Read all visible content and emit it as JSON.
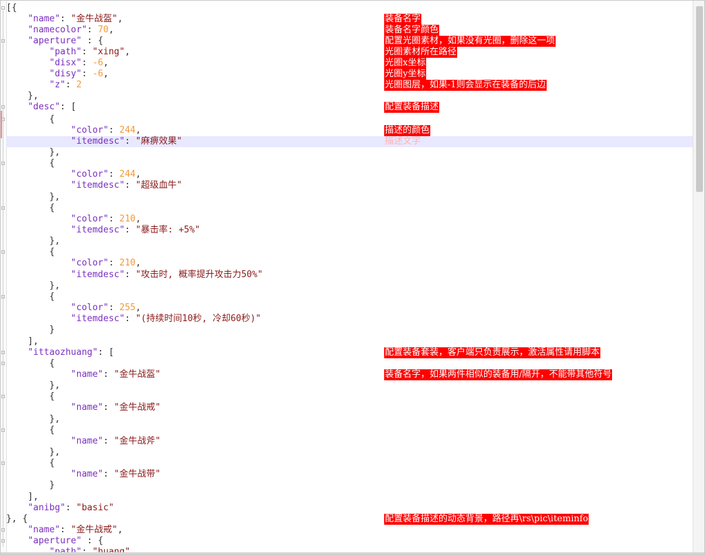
{
  "editor": {
    "current_line_index": 12,
    "lines": [
      [
        [
          "p",
          "[{"
        ]
      ],
      [
        [
          "p",
          "    "
        ],
        [
          "k",
          "\"name\""
        ],
        [
          "p",
          ": "
        ],
        [
          "s",
          "\"金牛战盔\""
        ],
        [
          "p",
          ","
        ]
      ],
      [
        [
          "p",
          "    "
        ],
        [
          "k",
          "\"namecolor\""
        ],
        [
          "p",
          ": "
        ],
        [
          "n",
          "70"
        ],
        [
          "p",
          ","
        ]
      ],
      [
        [
          "p",
          "    "
        ],
        [
          "k",
          "\"aperture\""
        ],
        [
          "p",
          " : {"
        ]
      ],
      [
        [
          "p",
          "        "
        ],
        [
          "k",
          "\"path\""
        ],
        [
          "p",
          ": "
        ],
        [
          "s",
          "\"xing\""
        ],
        [
          "p",
          ","
        ]
      ],
      [
        [
          "p",
          "        "
        ],
        [
          "k",
          "\"disx\""
        ],
        [
          "p",
          ": "
        ],
        [
          "n",
          "-6"
        ],
        [
          "p",
          ","
        ]
      ],
      [
        [
          "p",
          "        "
        ],
        [
          "k",
          "\"disy\""
        ],
        [
          "p",
          ": "
        ],
        [
          "n",
          "-6"
        ],
        [
          "p",
          ","
        ]
      ],
      [
        [
          "p",
          "        "
        ],
        [
          "k",
          "\"z\""
        ],
        [
          "p",
          ": "
        ],
        [
          "n",
          "2"
        ]
      ],
      [
        [
          "p",
          "    },"
        ]
      ],
      [
        [
          "p",
          "    "
        ],
        [
          "k",
          "\"desc\""
        ],
        [
          "p",
          ": ["
        ]
      ],
      [
        [
          "p",
          "        {"
        ]
      ],
      [
        [
          "p",
          "            "
        ],
        [
          "k",
          "\"color\""
        ],
        [
          "p",
          ": "
        ],
        [
          "n",
          "244"
        ],
        [
          "p",
          ","
        ]
      ],
      [
        [
          "p",
          "            "
        ],
        [
          "k",
          "\"itemdesc\""
        ],
        [
          "p",
          ": "
        ],
        [
          "s",
          "\"麻痹效果\""
        ]
      ],
      [
        [
          "p",
          "        },"
        ]
      ],
      [
        [
          "p",
          "        {"
        ]
      ],
      [
        [
          "p",
          "            "
        ],
        [
          "k",
          "\"color\""
        ],
        [
          "p",
          ": "
        ],
        [
          "n",
          "244"
        ],
        [
          "p",
          ","
        ]
      ],
      [
        [
          "p",
          "            "
        ],
        [
          "k",
          "\"itemdesc\""
        ],
        [
          "p",
          ": "
        ],
        [
          "s",
          "\"超级血牛\""
        ]
      ],
      [
        [
          "p",
          "        },"
        ]
      ],
      [
        [
          "p",
          "        {"
        ]
      ],
      [
        [
          "p",
          "            "
        ],
        [
          "k",
          "\"color\""
        ],
        [
          "p",
          ": "
        ],
        [
          "n",
          "210"
        ],
        [
          "p",
          ","
        ]
      ],
      [
        [
          "p",
          "            "
        ],
        [
          "k",
          "\"itemdesc\""
        ],
        [
          "p",
          ": "
        ],
        [
          "s",
          "\"暴击率: +5%\""
        ]
      ],
      [
        [
          "p",
          "        },"
        ]
      ],
      [
        [
          "p",
          "        {"
        ]
      ],
      [
        [
          "p",
          "            "
        ],
        [
          "k",
          "\"color\""
        ],
        [
          "p",
          ": "
        ],
        [
          "n",
          "210"
        ],
        [
          "p",
          ","
        ]
      ],
      [
        [
          "p",
          "            "
        ],
        [
          "k",
          "\"itemdesc\""
        ],
        [
          "p",
          ": "
        ],
        [
          "s",
          "\"攻击时, 概率提升攻击力50%\""
        ]
      ],
      [
        [
          "p",
          "        },"
        ]
      ],
      [
        [
          "p",
          "        {"
        ]
      ],
      [
        [
          "p",
          "            "
        ],
        [
          "k",
          "\"color\""
        ],
        [
          "p",
          ": "
        ],
        [
          "n",
          "255"
        ],
        [
          "p",
          ","
        ]
      ],
      [
        [
          "p",
          "            "
        ],
        [
          "k",
          "\"itemdesc\""
        ],
        [
          "p",
          ": "
        ],
        [
          "s",
          "\"(持续时间10秒, 冷却60秒)\""
        ]
      ],
      [
        [
          "p",
          "        }"
        ]
      ],
      [
        [
          "p",
          "    ],"
        ]
      ],
      [
        [
          "p",
          "    "
        ],
        [
          "k",
          "\"ittaozhuang\""
        ],
        [
          "p",
          ": ["
        ]
      ],
      [
        [
          "p",
          "        {"
        ]
      ],
      [
        [
          "p",
          "            "
        ],
        [
          "k",
          "\"name\""
        ],
        [
          "p",
          ": "
        ],
        [
          "s",
          "\"金牛战盔\""
        ]
      ],
      [
        [
          "p",
          "        },"
        ]
      ],
      [
        [
          "p",
          "        {"
        ]
      ],
      [
        [
          "p",
          "            "
        ],
        [
          "k",
          "\"name\""
        ],
        [
          "p",
          ": "
        ],
        [
          "s",
          "\"金牛战戒\""
        ]
      ],
      [
        [
          "p",
          "        },"
        ]
      ],
      [
        [
          "p",
          "        {"
        ]
      ],
      [
        [
          "p",
          "            "
        ],
        [
          "k",
          "\"name\""
        ],
        [
          "p",
          ": "
        ],
        [
          "s",
          "\"金牛战斧\""
        ]
      ],
      [
        [
          "p",
          "        },"
        ]
      ],
      [
        [
          "p",
          "        {"
        ]
      ],
      [
        [
          "p",
          "            "
        ],
        [
          "k",
          "\"name\""
        ],
        [
          "p",
          ": "
        ],
        [
          "s",
          "\"金牛战带\""
        ]
      ],
      [
        [
          "p",
          "        }"
        ]
      ],
      [
        [
          "p",
          "    ],"
        ]
      ],
      [
        [
          "p",
          "    "
        ],
        [
          "k",
          "\"anibg\""
        ],
        [
          "p",
          ": "
        ],
        [
          "s",
          "\"basic\""
        ]
      ],
      [
        [
          "p",
          "}, {"
        ]
      ],
      [
        [
          "p",
          "    "
        ],
        [
          "k",
          "\"name\""
        ],
        [
          "p",
          ": "
        ],
        [
          "s",
          "\"金牛战戒\""
        ],
        [
          "p",
          ","
        ]
      ],
      [
        [
          "p",
          "    "
        ],
        [
          "k",
          "\"aperture\""
        ],
        [
          "p",
          " : {"
        ]
      ],
      [
        [
          "p",
          "        "
        ],
        [
          "k",
          "\"path\""
        ],
        [
          "p",
          ": "
        ],
        [
          "s",
          "\"huang\""
        ]
      ]
    ]
  },
  "annotations": [
    {
      "line": 1,
      "text": "装备名字"
    },
    {
      "line": 2,
      "text": "装备名字颜色"
    },
    {
      "line": 3,
      "text": "配置光圈素材，如果没有光圈，删除这一项"
    },
    {
      "line": 4,
      "text": "光圈素材所在路径"
    },
    {
      "line": 5,
      "text": "光圈x坐标"
    },
    {
      "line": 6,
      "text": "光圈y坐标"
    },
    {
      "line": 7,
      "text": "光圈图层，如果-1则会显示在装备的后边"
    },
    {
      "line": 9,
      "text": "配置装备描述"
    },
    {
      "line": 11,
      "text": "描述的颜色"
    },
    {
      "line": 12,
      "text": "描述文字",
      "faded": true
    },
    {
      "line": 31,
      "text": "配置装备套装，客户端只负责展示，激活属性请用脚本"
    },
    {
      "line": 33,
      "text": "装备名字，如果两件相似的装备用/隔开，不能带其他符号"
    },
    {
      "line": 46,
      "text": "配置装备描述的动态背景，路径再\\rs\\pic\\iteminfo"
    }
  ],
  "colors": {
    "key": "#7b2fbf",
    "string": "#8a1a1a",
    "number": "#f39a3a",
    "annotation_bg": "#ff0000",
    "annotation_text": "#ffffff",
    "current_line": "#e8e8ff"
  }
}
